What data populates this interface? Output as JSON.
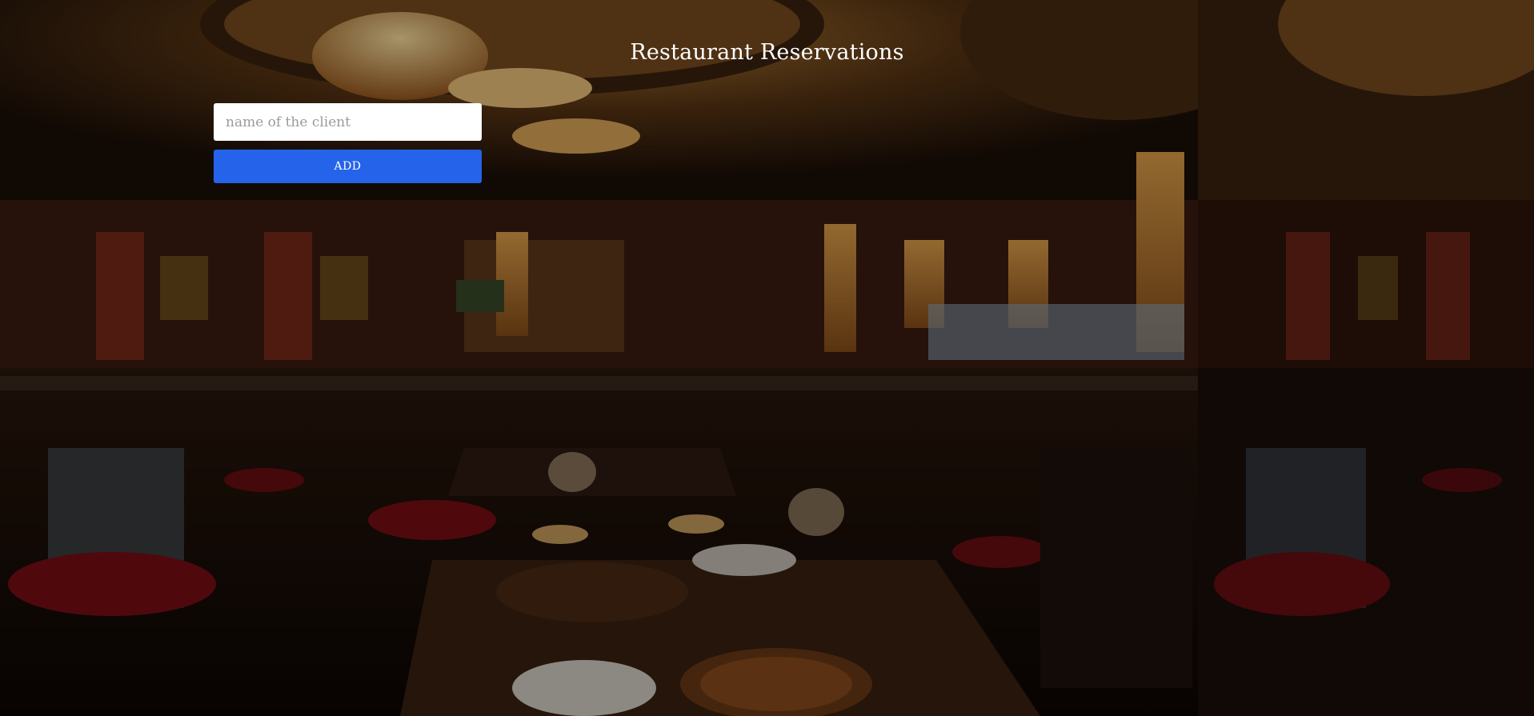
{
  "page": {
    "title": "Restaurant Reservations"
  },
  "reservation_form": {
    "client_name_placeholder": "name of the client",
    "client_name_value": "",
    "add_label": "ADD"
  },
  "colors": {
    "add_button": "#2563eb",
    "title_text": "#ffffff",
    "input_background": "#ffffff"
  }
}
